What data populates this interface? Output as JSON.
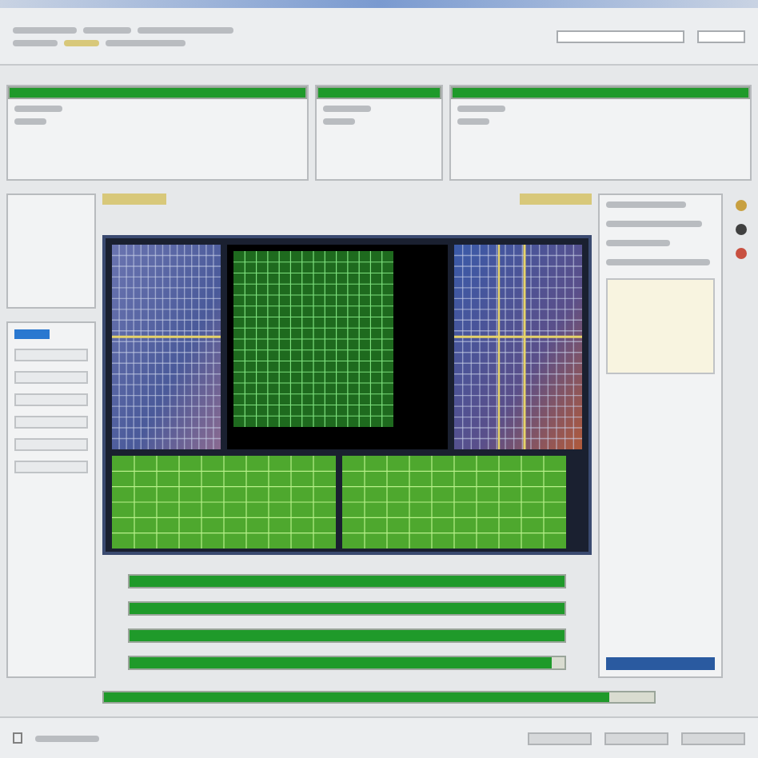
{
  "header_bars": [
    {
      "level": 1
    },
    {
      "level": 1
    },
    {
      "level": 1
    }
  ],
  "side_list": [
    {
      "selected": false
    },
    {
      "selected": false
    },
    {
      "selected": false
    },
    {
      "selected": false
    },
    {
      "selected": false
    },
    {
      "selected": false
    }
  ],
  "progress_rows": [
    {
      "level": 1
    },
    {
      "level": 1
    },
    {
      "level": 1
    },
    {
      "level": 0.97
    }
  ],
  "status_bar": {
    "level": 0.92
  }
}
